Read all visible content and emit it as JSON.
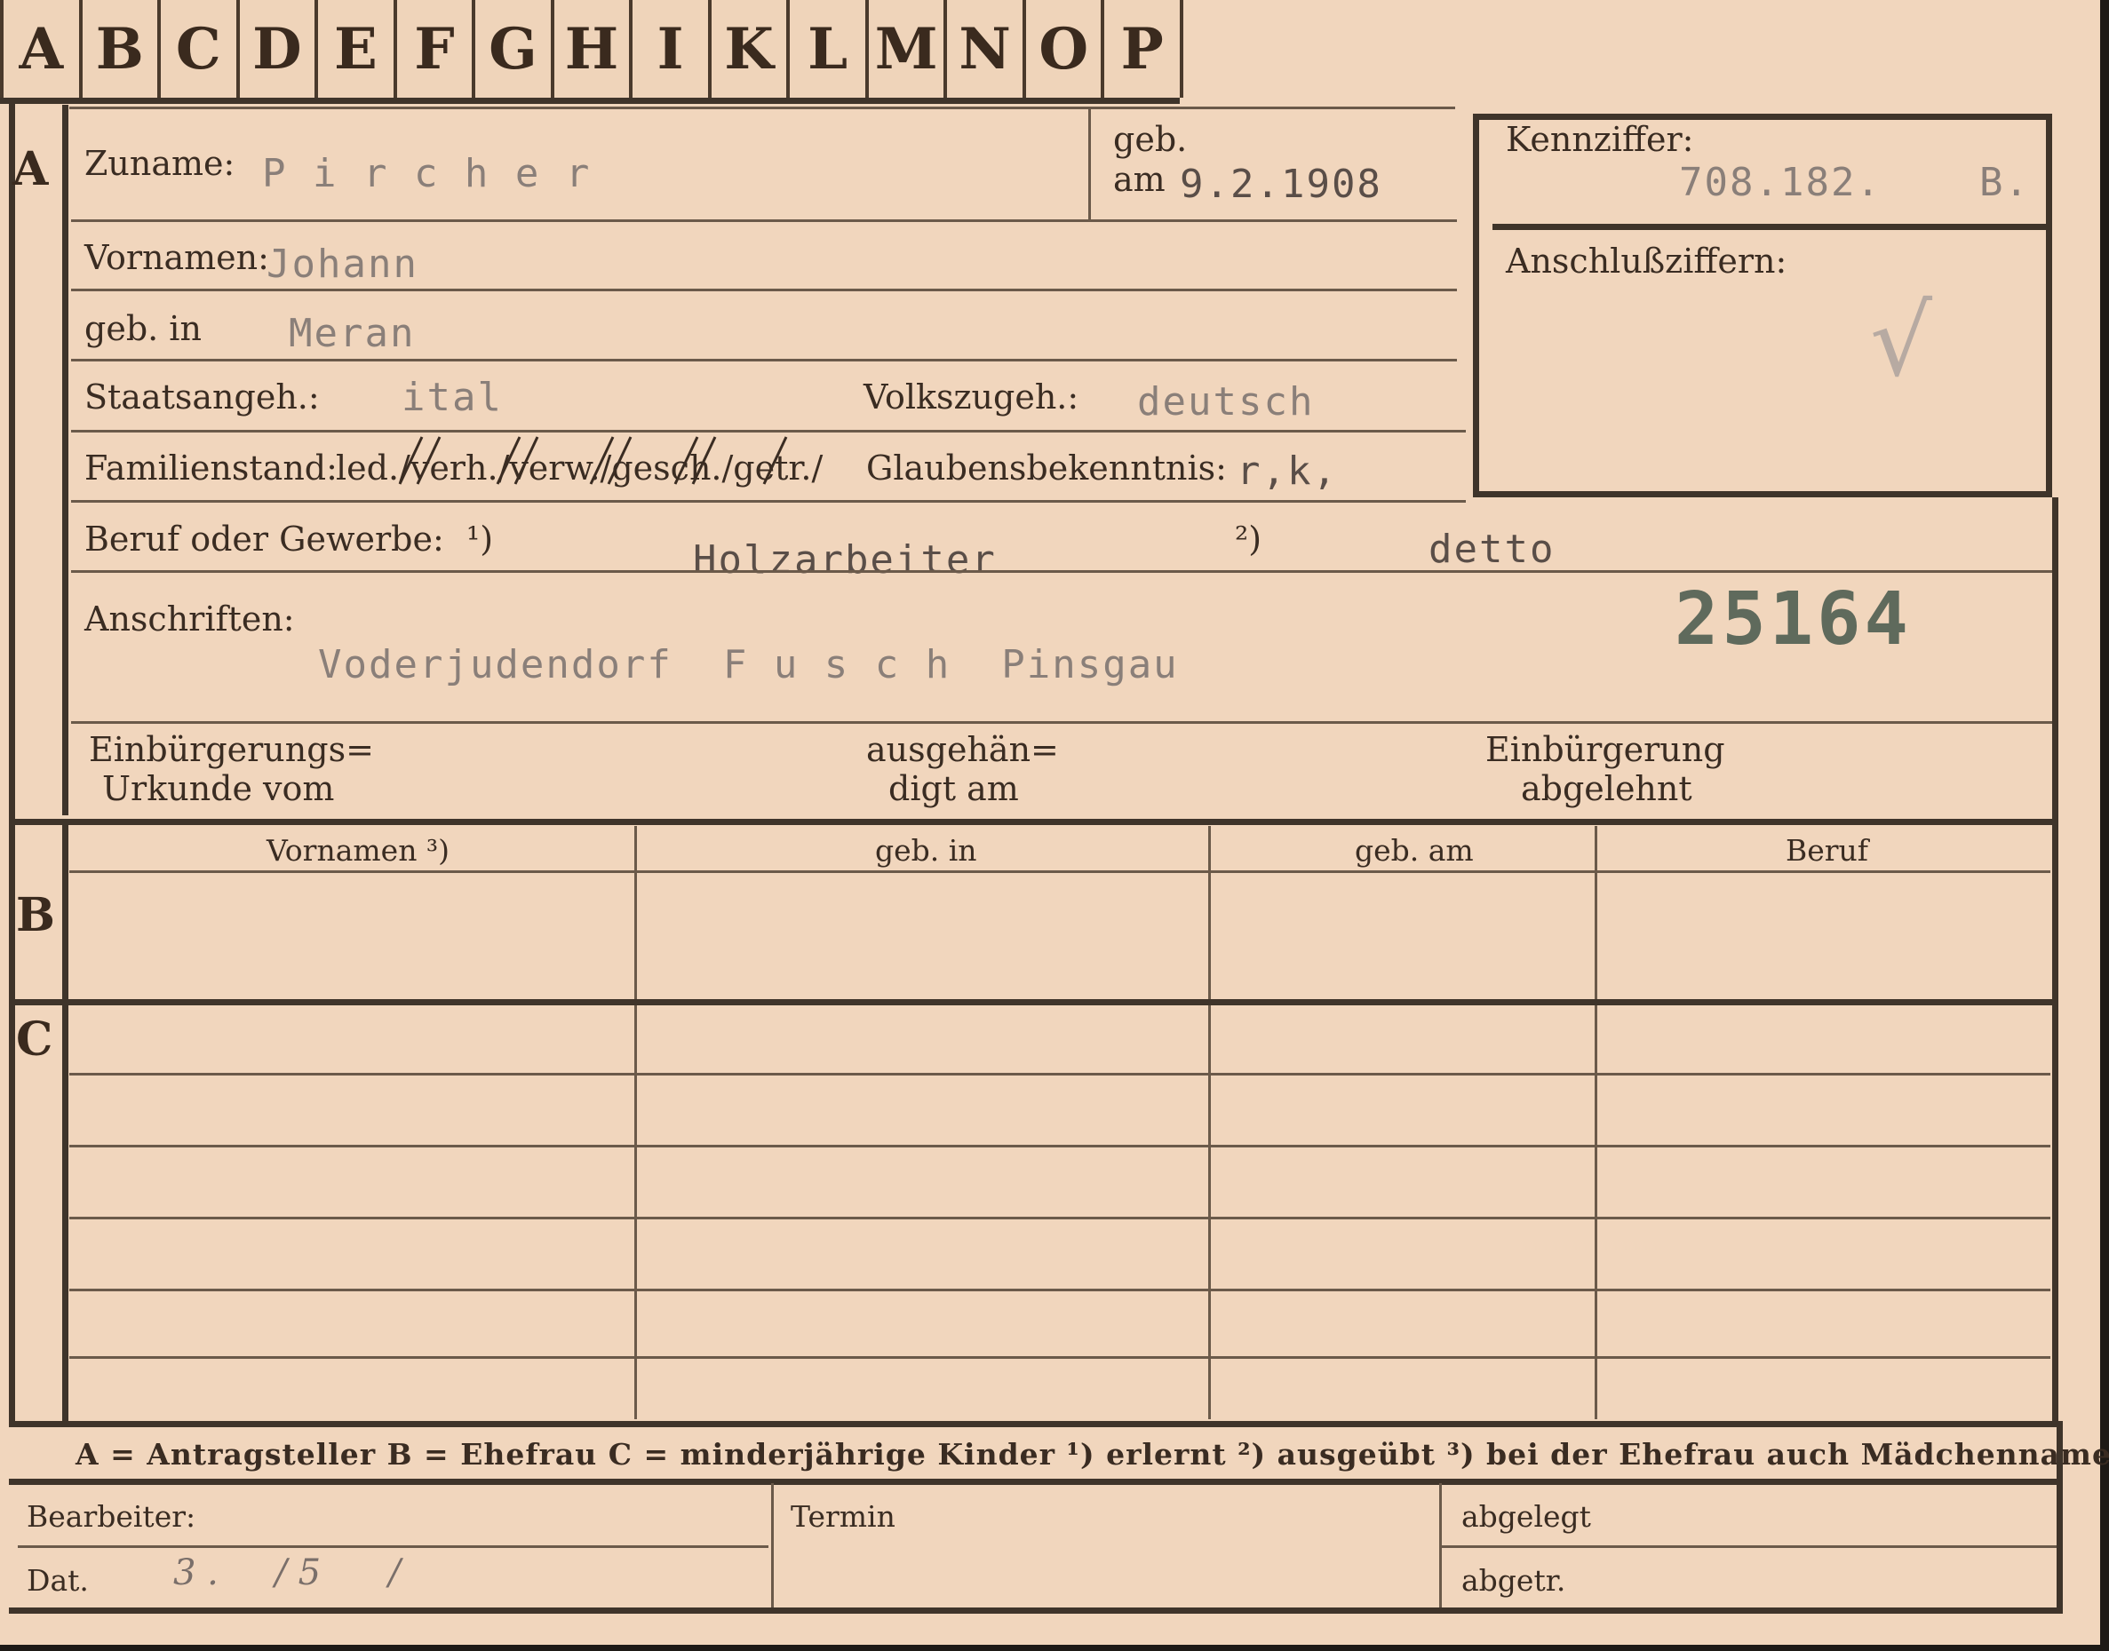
{
  "tabs": [
    "A",
    "B",
    "C",
    "D",
    "E",
    "F",
    "G",
    "H",
    "I",
    "K",
    "L",
    "M",
    "N",
    "O",
    "P"
  ],
  "sections": {
    "a": "A",
    "b": "B",
    "c": "C"
  },
  "applicant": {
    "surname_label": "Zuname:",
    "surname_value": "P i r c h e r",
    "dob_label_top": "geb.",
    "dob_label_bottom": "am",
    "dob_value": "9.2.1908",
    "id_label": "Kennziffer:",
    "id_value": "708.182.",
    "id_suffix": "B.",
    "ref_label": "Anschlußziffern:",
    "ref_mark": "√",
    "firstnames_label": "Vornamen:",
    "firstnames_value": "Johann",
    "birthplace_label": "geb. in",
    "birthplace_value": "Meran",
    "citizenship_label": "Staatsangeh.:",
    "citizenship_value": "ital",
    "ethnicity_label": "Volkszugeh.:",
    "ethnicity_value": "deutsch",
    "marital_label": "Familienstand:",
    "marital_options": "led./verh./verw./gesch./getr./",
    "religion_label": "Glaubensbekenntnis:",
    "religion_value": "r,k,",
    "occupation_label": "Beruf oder Gewerbe:",
    "occupation_mark1": "¹)",
    "occupation_value1": "Holzarbeiter",
    "occupation_mark2": "²)",
    "occupation_value2": "detto",
    "address_label": "Anschriften:",
    "address_value": "Voderjudendorf  F u s c h  Pinsgau",
    "stamp_number": "25164",
    "naturalization_cert_1": "Einbürgerungs=",
    "naturalization_cert_2": "Urkunde vom",
    "handed_1": "ausgehän=",
    "handed_2": "digt am",
    "denied_1": "Einbürgerung",
    "denied_2": "abgelehnt"
  },
  "table_headers": [
    "Vornamen ³)",
    "geb. in",
    "geb. am",
    "Beruf"
  ],
  "legend": "A = Antragsteller   B = Ehefrau   C = minderjährige Kinder   ¹) erlernt   ²) ausgeübt   ³) bei der Ehefrau auch Mädchenname",
  "footer": {
    "clerk_label": "Bearbeiter:",
    "date_label": "Dat.",
    "date_value": "3 .     / 5      /",
    "deadline_label": "Termin",
    "filed_label": "abgelegt",
    "dispatched_label": "abgetr."
  }
}
